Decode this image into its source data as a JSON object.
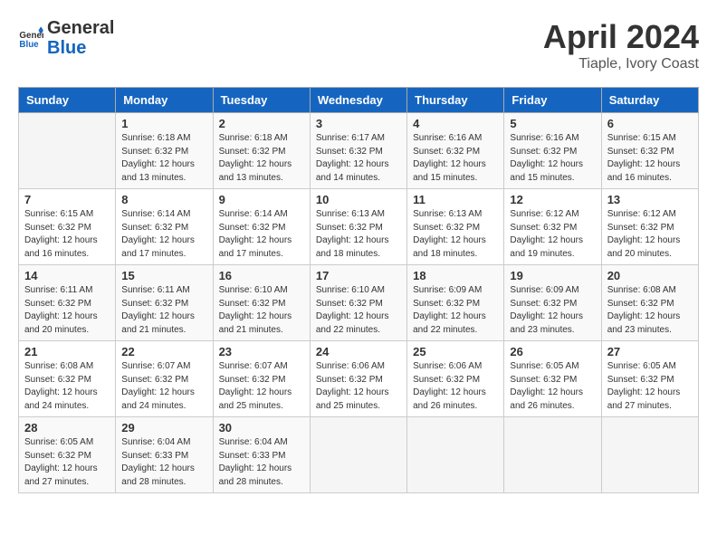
{
  "header": {
    "logo_line1": "General",
    "logo_line2": "Blue",
    "month": "April 2024",
    "location": "Tiaple, Ivory Coast"
  },
  "days_of_week": [
    "Sunday",
    "Monday",
    "Tuesday",
    "Wednesday",
    "Thursday",
    "Friday",
    "Saturday"
  ],
  "weeks": [
    [
      {
        "day": "",
        "info": ""
      },
      {
        "day": "1",
        "info": "Sunrise: 6:18 AM\nSunset: 6:32 PM\nDaylight: 12 hours\nand 13 minutes."
      },
      {
        "day": "2",
        "info": "Sunrise: 6:18 AM\nSunset: 6:32 PM\nDaylight: 12 hours\nand 13 minutes."
      },
      {
        "day": "3",
        "info": "Sunrise: 6:17 AM\nSunset: 6:32 PM\nDaylight: 12 hours\nand 14 minutes."
      },
      {
        "day": "4",
        "info": "Sunrise: 6:16 AM\nSunset: 6:32 PM\nDaylight: 12 hours\nand 15 minutes."
      },
      {
        "day": "5",
        "info": "Sunrise: 6:16 AM\nSunset: 6:32 PM\nDaylight: 12 hours\nand 15 minutes."
      },
      {
        "day": "6",
        "info": "Sunrise: 6:15 AM\nSunset: 6:32 PM\nDaylight: 12 hours\nand 16 minutes."
      }
    ],
    [
      {
        "day": "7",
        "info": "Sunrise: 6:15 AM\nSunset: 6:32 PM\nDaylight: 12 hours\nand 16 minutes."
      },
      {
        "day": "8",
        "info": "Sunrise: 6:14 AM\nSunset: 6:32 PM\nDaylight: 12 hours\nand 17 minutes."
      },
      {
        "day": "9",
        "info": "Sunrise: 6:14 AM\nSunset: 6:32 PM\nDaylight: 12 hours\nand 17 minutes."
      },
      {
        "day": "10",
        "info": "Sunrise: 6:13 AM\nSunset: 6:32 PM\nDaylight: 12 hours\nand 18 minutes."
      },
      {
        "day": "11",
        "info": "Sunrise: 6:13 AM\nSunset: 6:32 PM\nDaylight: 12 hours\nand 18 minutes."
      },
      {
        "day": "12",
        "info": "Sunrise: 6:12 AM\nSunset: 6:32 PM\nDaylight: 12 hours\nand 19 minutes."
      },
      {
        "day": "13",
        "info": "Sunrise: 6:12 AM\nSunset: 6:32 PM\nDaylight: 12 hours\nand 20 minutes."
      }
    ],
    [
      {
        "day": "14",
        "info": "Sunrise: 6:11 AM\nSunset: 6:32 PM\nDaylight: 12 hours\nand 20 minutes."
      },
      {
        "day": "15",
        "info": "Sunrise: 6:11 AM\nSunset: 6:32 PM\nDaylight: 12 hours\nand 21 minutes."
      },
      {
        "day": "16",
        "info": "Sunrise: 6:10 AM\nSunset: 6:32 PM\nDaylight: 12 hours\nand 21 minutes."
      },
      {
        "day": "17",
        "info": "Sunrise: 6:10 AM\nSunset: 6:32 PM\nDaylight: 12 hours\nand 22 minutes."
      },
      {
        "day": "18",
        "info": "Sunrise: 6:09 AM\nSunset: 6:32 PM\nDaylight: 12 hours\nand 22 minutes."
      },
      {
        "day": "19",
        "info": "Sunrise: 6:09 AM\nSunset: 6:32 PM\nDaylight: 12 hours\nand 23 minutes."
      },
      {
        "day": "20",
        "info": "Sunrise: 6:08 AM\nSunset: 6:32 PM\nDaylight: 12 hours\nand 23 minutes."
      }
    ],
    [
      {
        "day": "21",
        "info": "Sunrise: 6:08 AM\nSunset: 6:32 PM\nDaylight: 12 hours\nand 24 minutes."
      },
      {
        "day": "22",
        "info": "Sunrise: 6:07 AM\nSunset: 6:32 PM\nDaylight: 12 hours\nand 24 minutes."
      },
      {
        "day": "23",
        "info": "Sunrise: 6:07 AM\nSunset: 6:32 PM\nDaylight: 12 hours\nand 25 minutes."
      },
      {
        "day": "24",
        "info": "Sunrise: 6:06 AM\nSunset: 6:32 PM\nDaylight: 12 hours\nand 25 minutes."
      },
      {
        "day": "25",
        "info": "Sunrise: 6:06 AM\nSunset: 6:32 PM\nDaylight: 12 hours\nand 26 minutes."
      },
      {
        "day": "26",
        "info": "Sunrise: 6:05 AM\nSunset: 6:32 PM\nDaylight: 12 hours\nand 26 minutes."
      },
      {
        "day": "27",
        "info": "Sunrise: 6:05 AM\nSunset: 6:32 PM\nDaylight: 12 hours\nand 27 minutes."
      }
    ],
    [
      {
        "day": "28",
        "info": "Sunrise: 6:05 AM\nSunset: 6:32 PM\nDaylight: 12 hours\nand 27 minutes."
      },
      {
        "day": "29",
        "info": "Sunrise: 6:04 AM\nSunset: 6:33 PM\nDaylight: 12 hours\nand 28 minutes."
      },
      {
        "day": "30",
        "info": "Sunrise: 6:04 AM\nSunset: 6:33 PM\nDaylight: 12 hours\nand 28 minutes."
      },
      {
        "day": "",
        "info": ""
      },
      {
        "day": "",
        "info": ""
      },
      {
        "day": "",
        "info": ""
      },
      {
        "day": "",
        "info": ""
      }
    ]
  ]
}
